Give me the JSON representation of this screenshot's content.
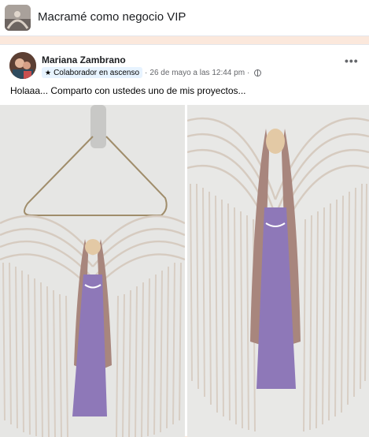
{
  "group": {
    "name": "Macramé como negocio VIP",
    "thumb_icon": "group-cover-thumbnail"
  },
  "post": {
    "author": "Mariana Zambrano",
    "badge": "Colaborador en ascenso",
    "badge_icon": "star-icon",
    "separator": "·",
    "timestamp": "26 de mayo a las 12:44 pm",
    "privacy_icon": "globe-icon",
    "more_label": "•••",
    "text": "Holaaa... Comparto con ustedes uno de mis proyectos..."
  },
  "colors": {
    "header_bg": "#ffffff",
    "page_bg": "#fbe8dc",
    "text": "#1c1e21",
    "muted": "#65676b",
    "fringe": "#d6cbc0",
    "angel_dress": "#8e78b8",
    "angel_hair": "#a8867d"
  }
}
